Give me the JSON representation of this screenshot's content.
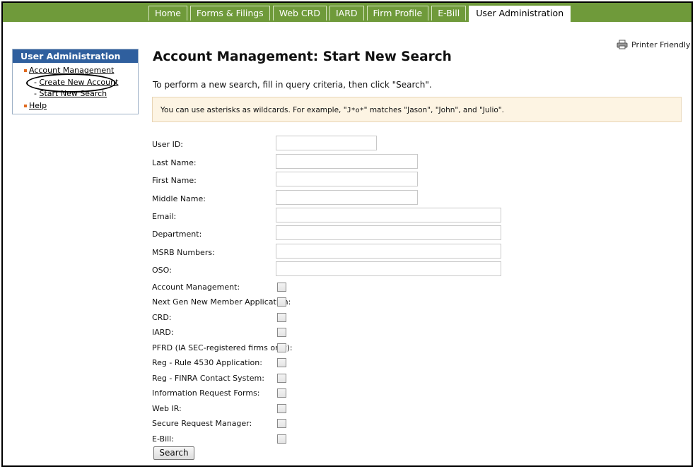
{
  "nav": {
    "tabs": [
      {
        "label": "Home"
      },
      {
        "label": "Forms & Filings"
      },
      {
        "label": "Web CRD"
      },
      {
        "label": "IARD"
      },
      {
        "label": "Firm Profile"
      },
      {
        "label": "E-Bill"
      },
      {
        "label": "User Administration",
        "active": true
      }
    ]
  },
  "printer_friendly": "Printer Friendly",
  "sidebar": {
    "title": "User Administration",
    "items": [
      {
        "label": "Account Management"
      },
      {
        "label": "- "
      },
      {
        "label": "Create New Account"
      },
      {
        "label": "- "
      },
      {
        "label": "Start New Search"
      },
      {
        "label": "Help"
      }
    ]
  },
  "page": {
    "title": "Account Management: Start New Search",
    "instruction": "To perform a new search, fill in query criteria, then click \"Search\".",
    "tip_prefix": "You can use asterisks as wildcards. For example, \"",
    "tip_code": "J*o*",
    "tip_suffix": "\" matches \"Jason\", \"John\", and \"Julio\"."
  },
  "form": {
    "text_fields": [
      {
        "label": "User ID:",
        "value": ""
      },
      {
        "label": "Last Name:",
        "value": ""
      },
      {
        "label": "First Name:",
        "value": ""
      },
      {
        "label": "Middle Name:",
        "value": ""
      },
      {
        "label": "Email:",
        "value": ""
      },
      {
        "label": "Department:",
        "value": ""
      },
      {
        "label": "MSRB Numbers:",
        "value": ""
      },
      {
        "label": "OSO:",
        "value": ""
      }
    ],
    "checkboxes": [
      {
        "label": "Account Management:",
        "checked": false
      },
      {
        "label": "Next Gen New Member Application:",
        "checked": false
      },
      {
        "label": "CRD:",
        "checked": false
      },
      {
        "label": "IARD:",
        "checked": false
      },
      {
        "label": "PFRD (IA SEC-registered firms only):",
        "checked": false
      },
      {
        "label": "Reg - Rule 4530 Application:",
        "checked": false
      },
      {
        "label": "Reg - FINRA Contact System:",
        "checked": false
      },
      {
        "label": "Information Request Forms:",
        "checked": false
      },
      {
        "label": "Web IR:",
        "checked": false
      },
      {
        "label": "Secure Request Manager:",
        "checked": false
      },
      {
        "label": "E-Bill:",
        "checked": false
      }
    ],
    "search_label": "Search"
  },
  "colors": {
    "nav_green": "#6f9a3a",
    "sidebar_blue": "#2f5f9e",
    "bullet_orange": "#e06a1f",
    "tip_background": "#fdf4e3"
  }
}
